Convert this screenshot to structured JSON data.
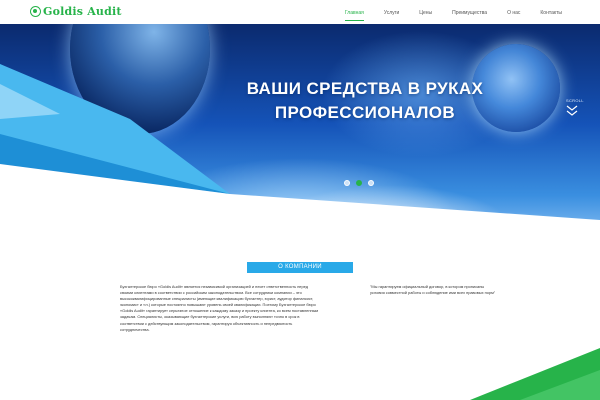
{
  "brand": {
    "name": "Goldis Audit"
  },
  "nav": {
    "items": [
      {
        "label": "Главная",
        "active": true
      },
      {
        "label": "Услуги",
        "active": false
      },
      {
        "label": "Цены",
        "active": false
      },
      {
        "label": "Преимущества",
        "active": false
      },
      {
        "label": "О нас",
        "active": false
      },
      {
        "label": "Контакты",
        "active": false
      }
    ]
  },
  "hero": {
    "headline_line1": "ВАШИ СРЕДСТВА В РУКАХ",
    "headline_line2": "ПРОФЕССИОНАЛОВ",
    "scroll_label": "SCROLL",
    "slides": 3,
    "active_slide": 1
  },
  "about": {
    "title": "О КОМПАНИИ",
    "text": "Бухгалтерское бюро «Goldis Audit» является независимой организацией и несет ответственность перед своими клиентами в соответствии с российским законодательством. Все сотрудники компании – это высококвалифицированные специалисты (имеющие квалификацию бухгалтер, юрист, аудитор финансист, экономист и т.п.) которые постоянно повышают уровень своей квалификации. Поэтому Бухгалтерское бюро «Goldis Audit» гарантирует серьезное отношение к каждому заказу и проекту клиента, ко всем поставленным задачам. Специалисты, оказывающие бухгалтерские услуги, всю работу выполняют точно в срок в соответствии с действующим законодательством, гарантируя объективность и непредвзятость сотрудничества.",
    "quote": "\"Мы гарантируем официальный договор, в котором прописаны условия совместной работы и соблюдение ими всех правовых норм\""
  },
  "colors": {
    "brand_green": "#27b34a",
    "accent_blue": "#29a9e8"
  }
}
